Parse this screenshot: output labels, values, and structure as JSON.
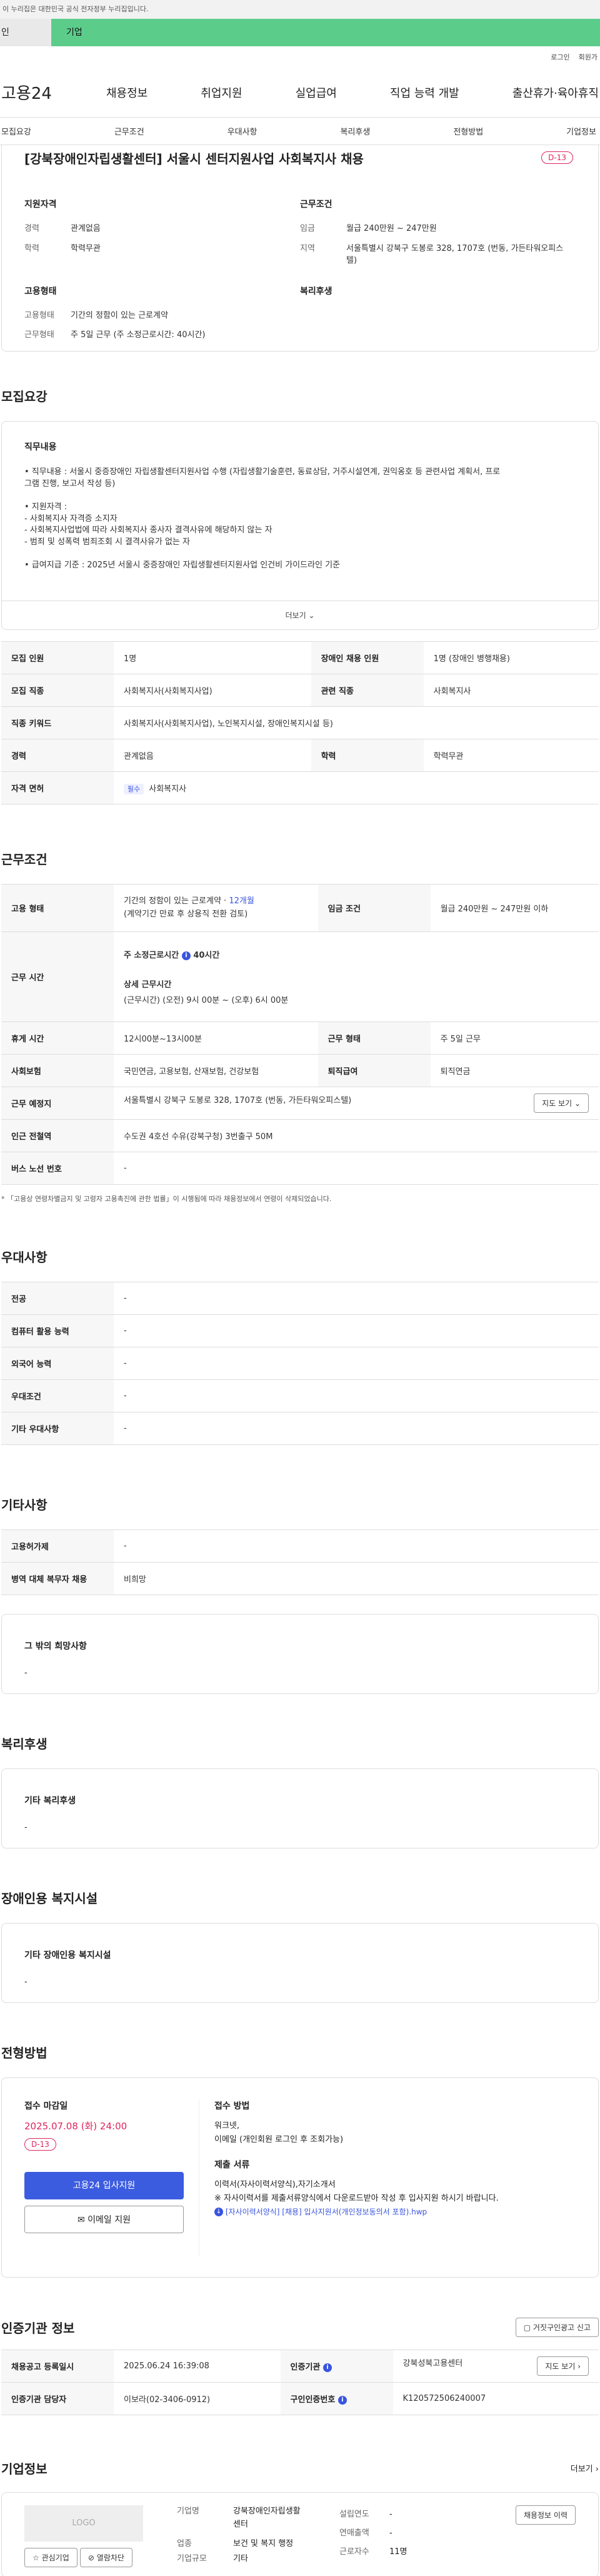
{
  "gov_banner": "이 누리집은 대한민국 공식 전자정부 누리집입니다.",
  "top_tabs": [
    "인",
    "기업"
  ],
  "util_links": [
    "로그인",
    "회원가"
  ],
  "logo": "고용24",
  "gnb": [
    "채용정보",
    "취업지원",
    "실업급여",
    "직업 능력 개발",
    "출산휴가·육아휴직"
  ],
  "subnav": [
    "모집요강",
    "근무조건",
    "우대사항",
    "복리후생",
    "전형방법",
    "기업정보"
  ],
  "job_title": "[강북장애인자립생활센터] 서울시 센터지원사업 사회복지사 채용",
  "dday": "D-13",
  "summary": {
    "qual_title": "지원자격",
    "qual": [
      {
        "k": "경력",
        "v": "관계없음"
      },
      {
        "k": "학력",
        "v": "학력무관"
      }
    ],
    "cond_title": "근무조건",
    "cond": [
      {
        "k": "임금",
        "v": "월급 240만원 ~ 247만원"
      },
      {
        "k": "지역",
        "v": "서울특별시 강북구 도봉로 328, 1707호 (번동, 가든타워오피스텔)"
      }
    ],
    "emp_title": "고용형태",
    "emp": [
      {
        "k": "고용형태",
        "v": "기간의 정함이 있는 근로계약"
      },
      {
        "k": "근무형태",
        "v": "주 5일 근무 (주 소정근로시간: 40시간)"
      }
    ],
    "welfare_title": "복리후생"
  },
  "recruit": {
    "title": "모집요강",
    "duty_title": "직무내용",
    "duty_lines": [
      "• 직무내용 : 서울시 중증장애인 자립생활센터지원사업 수행 (자립생활기술훈련, 동료상담, 거주시설연계, 권익옹호 등 관련사업 계획서, 프로",
      "그램 진행, 보고서 작성 등)",
      "",
      "• 지원자격 :",
      "- 사회복지사 자격증 소지자",
      "- 사회복지사업법에 따라 사회복지사 종사자 결격사유에 해당하지 않는 자",
      "- 범죄 및 성폭력 범죄조회 시 결격사유가 없는 자",
      "",
      "• 급여지급 기준 : 2025년 서울시 중증장애인 자립생활센터지원사업 인건비 가이드라인 기준"
    ],
    "more": "더보기",
    "rows": [
      {
        "k1": "모집 인원",
        "v1": "1명",
        "k2": "장애인 채용 인원",
        "v2": "1명 (장애인 병행채용)"
      },
      {
        "k1": "모집 직종",
        "v1": "사회복지사(사회복지사업)",
        "k2": "관련 직종",
        "v2": "사회복지사"
      },
      {
        "k1": "직종 키워드",
        "v1": "사회복지사(사회복지사업), 노인복지시설, 장애인복지시설 등)",
        "k2": "",
        "v2": ""
      },
      {
        "k1": "경력",
        "v1": "관계없음",
        "k2": "학력",
        "v2": "학력무관"
      }
    ],
    "license_k": "자격 면허",
    "license_tag": "필수",
    "license_v": "사회복지사"
  },
  "work": {
    "title": "근무조건",
    "emp_k": "고용 형태",
    "emp_v1": "기간의 정함이 있는 근로계약 · ",
    "emp_v1_hl": "12개월",
    "emp_v2": "(계약기간 만료 후 상용직 전환 검토)",
    "wage_k": "임금 조건",
    "wage_v": "월급 240만원 ~ 247만원 이하",
    "hours_k": "근무 시간",
    "hours_v1": "주 소정근로시간",
    "hours_v1b": "40시간",
    "hours_v2": "상세 근무시간",
    "hours_v3": "(근무시간) (오전) 9시 00분 ~ (오후) 6시 00분",
    "rows": [
      {
        "k1": "휴게 시간",
        "v1": "12시00분~13시00분",
        "k2": "근무 형태",
        "v2": "주 5일 근무"
      },
      {
        "k1": "사회보험",
        "v1": "국민연금, 고용보험, 산재보험, 건강보험",
        "k2": "퇴직급여",
        "v2": "퇴직연금"
      }
    ],
    "loc_k": "근무 예정지",
    "loc_v": "서울특별시 강북구 도봉로 328, 1707호 (번동, 가든타워오피스텔)",
    "map_btn": "지도 보기",
    "station_k": "인근 전철역",
    "station_v": "수도권 4호선 수유(강북구청) 3번출구 50M",
    "bus_k": "버스 노선 번호",
    "bus_v": "-",
    "note": "* 「고용상 연령차별금지 및 고령자 고용촉진에 관한 법률」이 시행됨에 따라 채용정보에서 연령이 삭제되었습니다."
  },
  "pref": {
    "title": "우대사항",
    "rows": [
      {
        "k": "전공",
        "v": "-"
      },
      {
        "k": "컴퓨터 활용 능력",
        "v": "-"
      },
      {
        "k": "외국어 능력",
        "v": "-"
      },
      {
        "k": "우대조건",
        "v": "-"
      },
      {
        "k": "기타 우대사항",
        "v": "-"
      }
    ]
  },
  "etc": {
    "title": "기타사항",
    "rows": [
      {
        "k": "고용허가제",
        "v": "-"
      },
      {
        "k": "병역 대체 복무자 채용",
        "v": "비희망"
      }
    ],
    "other_title": "그 밖의 희망사항",
    "other_v": "-"
  },
  "welfare": {
    "title": "복리후생",
    "box_title": "기타 복리후생",
    "box_v": "-"
  },
  "disab": {
    "title": "장애인용 복지시설",
    "box_title": "기타 장애인용 복지시설",
    "box_v": "-"
  },
  "apply": {
    "title": "전형방법",
    "deadline_title": "접수 마감일",
    "deadline": "2025.07.08 (화) 24:00",
    "dday": "D-13",
    "apply_btn": "고용24 입사지원",
    "email_btn": "이메일 지원",
    "method_title": "접수 방법",
    "method_v1": "워크넷,",
    "method_v2": "이메일 (개인회원 로그인 후 조회가능)",
    "docs_title": "제출 서류",
    "docs_v1": "이력서(자사이력서양식),자기소개서",
    "docs_v2": "※ 자사이력서를 제출서류양식에서 다운로드받아 작성 후 입사지원 하시기 바랍니다.",
    "docs_link": "[자사이력서양식] [채용] 입사지원서(개인정보동의서 포함).hwp"
  },
  "cert": {
    "title": "인증기관 정보",
    "report_btn": "거짓구인광고 신고",
    "rows": [
      {
        "k1": "채용공고 등록일시",
        "v1": "2025.06.24 16:39:08",
        "k2": "인증기관",
        "v2": "강북성북고용센터",
        "btn": "지도 보기"
      },
      {
        "k1": "인증기관 담당자",
        "v1": "이보라(02-3406-0912)",
        "k2": "구인인증번호",
        "v2": "K120572506240007",
        "btn": ""
      }
    ]
  },
  "company": {
    "title": "기업정보",
    "more": "더보기",
    "logo": "LOGO",
    "fav_btn": "관심기업",
    "block_btn": "열람차단",
    "rows": [
      {
        "k": "기업명",
        "v": "강북장애인자립생활센터"
      },
      {
        "k": "업종",
        "v": "보건 및 복지 행정"
      },
      {
        "k": "기업규모",
        "v": "기타"
      }
    ],
    "rows2": [
      {
        "k": "설립연도",
        "v": "-"
      },
      {
        "k": "연매출액",
        "v": "-"
      },
      {
        "k": "근로자수",
        "v": "11명"
      }
    ],
    "history_btn": "채용정보 이력"
  }
}
